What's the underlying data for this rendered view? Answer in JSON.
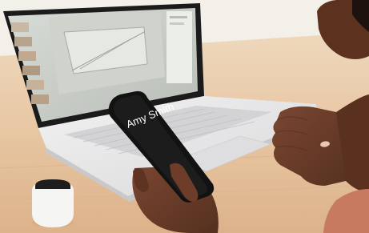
{
  "photo": {
    "phone_screen": {
      "caller_name": "Amy Smith",
      "caller_subtitle": ""
    },
    "colors": {
      "table": "#e9c9a6",
      "wall": "#f2eee9",
      "laptop_body": "#e7e7e8",
      "keys": "#d6d6d8",
      "phone": "#141414",
      "skin": "#6b3c29",
      "earbuds_case": "#f4f4f2"
    }
  }
}
